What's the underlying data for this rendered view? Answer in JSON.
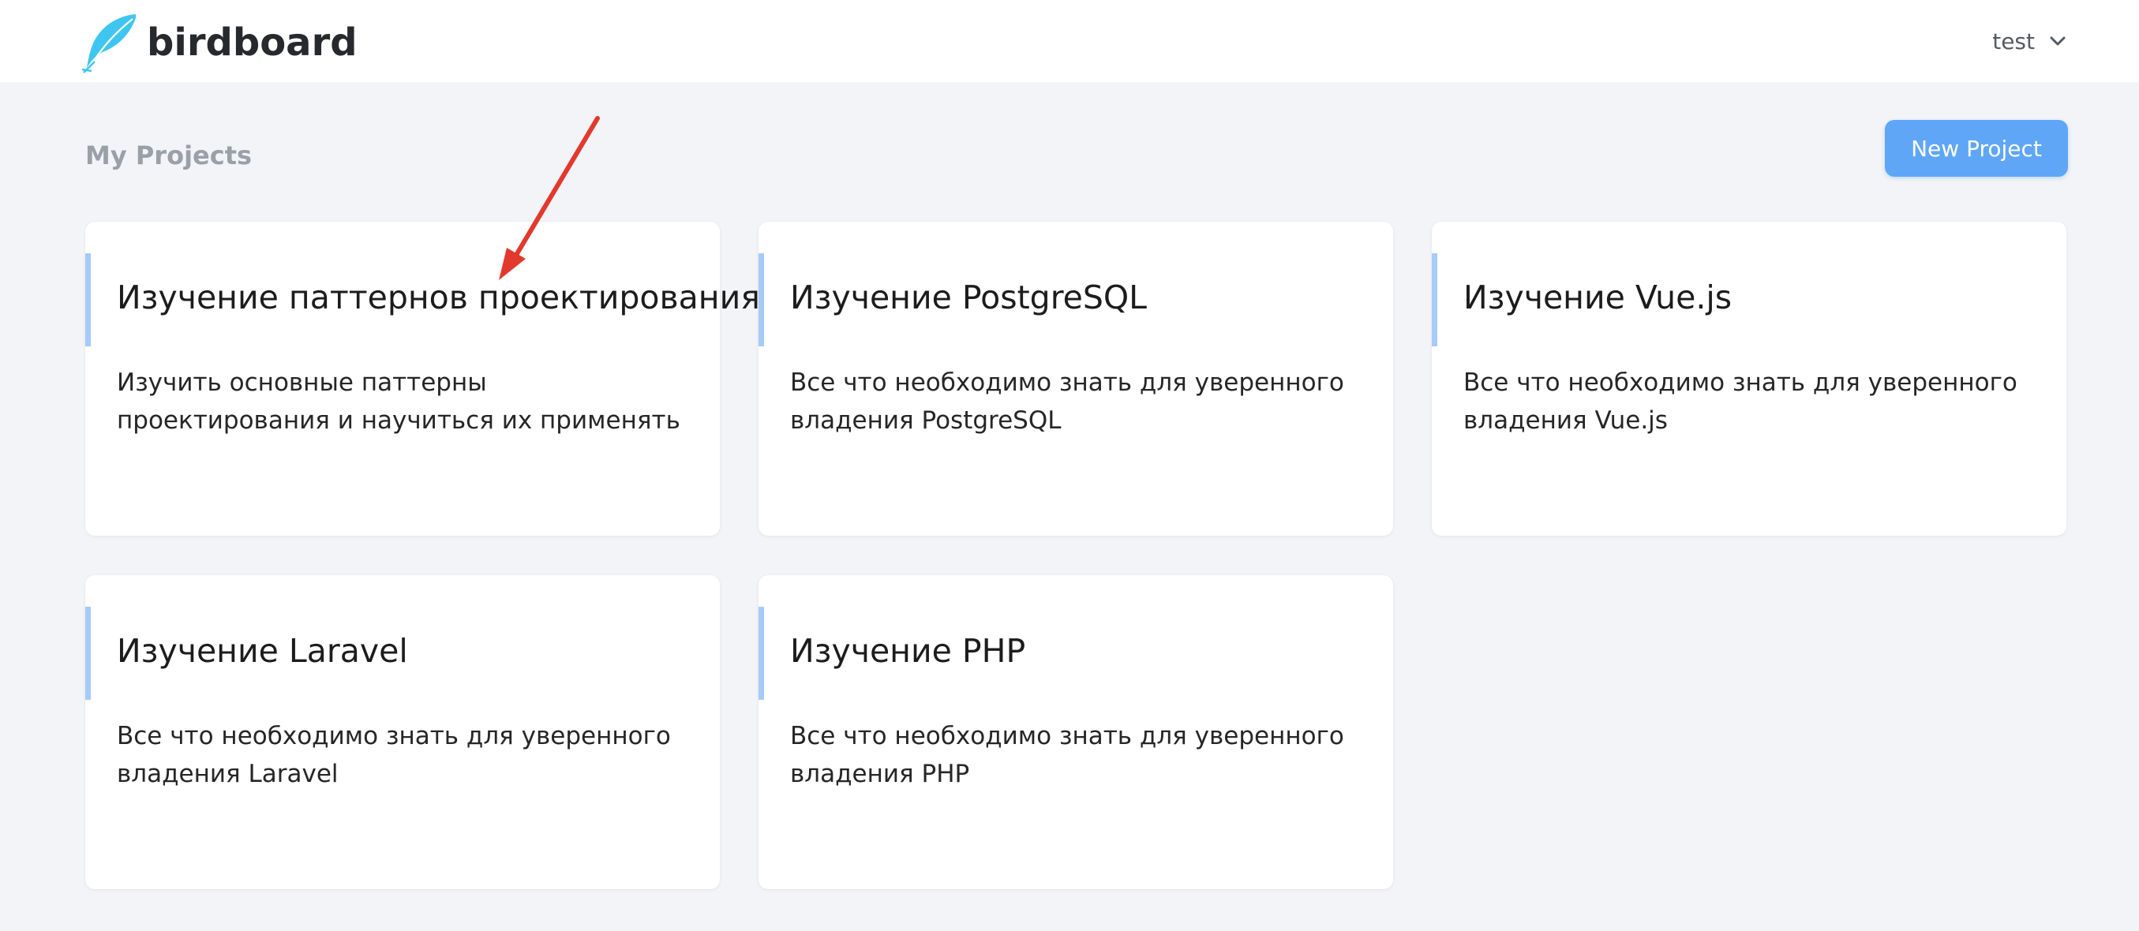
{
  "app": {
    "name": "birdboard",
    "logo_icon": "feather-icon"
  },
  "user_menu": {
    "name": "test",
    "icon": "chevron-down-icon"
  },
  "page": {
    "title": "My Projects",
    "new_button_label": "New Project"
  },
  "colors": {
    "accent": "#5fa6f6",
    "card_bar": "#a6cbf8",
    "annotation_arrow": "#e2392d",
    "logo": "#3fc6f0"
  },
  "projects": [
    {
      "title": "Изучение паттернов проектирования",
      "description": "Изучить основные паттерны проектирования и научиться их применять"
    },
    {
      "title": "Изучение PostgreSQL",
      "description": "Все что необходимо знать для уверенного владения PostgreSQL"
    },
    {
      "title": "Изучение Vue.js",
      "description": "Все что необходимо знать для уверенного владения Vue.js"
    },
    {
      "title": "Изучение Laravel",
      "description": "Все что необходимо знать для уверенного владения Laravel"
    },
    {
      "title": "Изучение PHP",
      "description": "Все что необходимо знать для уверенного владения PHP"
    }
  ]
}
